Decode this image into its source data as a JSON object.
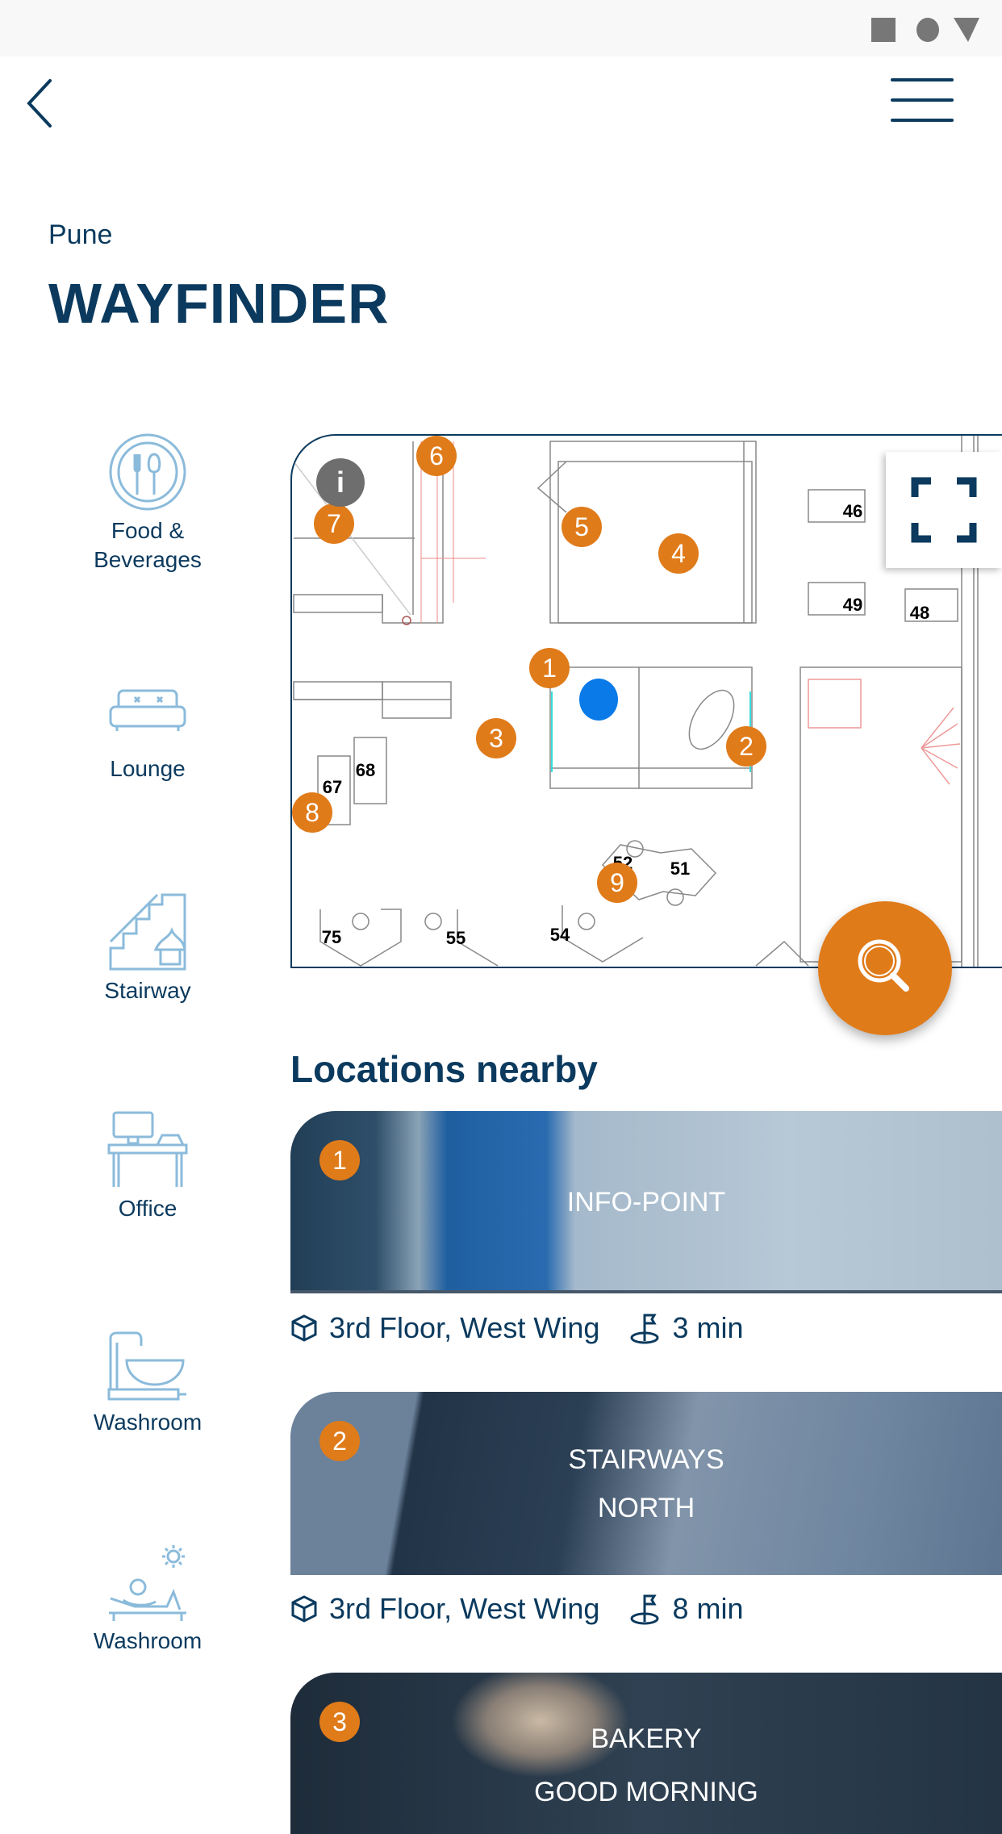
{
  "status_bar": {
    "icons": [
      "square-icon",
      "circle-icon",
      "triangle-icon"
    ]
  },
  "header": {
    "back_icon": "chevron-left-icon",
    "menu_icon": "hamburger-icon"
  },
  "page": {
    "city": "Pune",
    "title": "WAYFINDER"
  },
  "sidebar": {
    "items": [
      {
        "label": "Food & Beverages",
        "line1": "Food &",
        "line2": "Beverages",
        "icon": "food-icon"
      },
      {
        "label": "Lounge",
        "icon": "sofa-icon"
      },
      {
        "label": "Stairway",
        "icon": "stairway-icon"
      },
      {
        "label": "Office",
        "icon": "office-desk-icon"
      },
      {
        "label": "Washroom",
        "icon": "washbasin-icon"
      },
      {
        "label": "Washroom",
        "icon": "sunbed-icon"
      }
    ]
  },
  "map": {
    "markers": [
      "1",
      "2",
      "3",
      "4",
      "5",
      "6",
      "7",
      "8",
      "9"
    ],
    "info_label": "i",
    "desks": [
      "46",
      "49",
      "48",
      "68",
      "67",
      "52",
      "51",
      "75",
      "55",
      "54"
    ],
    "colors": {
      "marker": "#e07b1a",
      "current_location": "#0a7ae8",
      "info": "#6e6e6e"
    }
  },
  "nearby": {
    "heading": "Locations nearby",
    "items": [
      {
        "number": "1",
        "title_line1": "INFO-POINT",
        "floor": "3rd Floor, West Wing",
        "time": "3 min"
      },
      {
        "number": "2",
        "title_line1": "STAIRWAYS",
        "title_line2": "NORTH",
        "floor": "3rd Floor, West Wing",
        "time": "8 min"
      },
      {
        "number": "3",
        "title_line1": "BAKERY",
        "title_line2": "GOOD MORNING"
      }
    ]
  },
  "colors": {
    "primary": "#0b3a5e",
    "accent": "#e07b1a",
    "icon": "#8bbbdb"
  }
}
